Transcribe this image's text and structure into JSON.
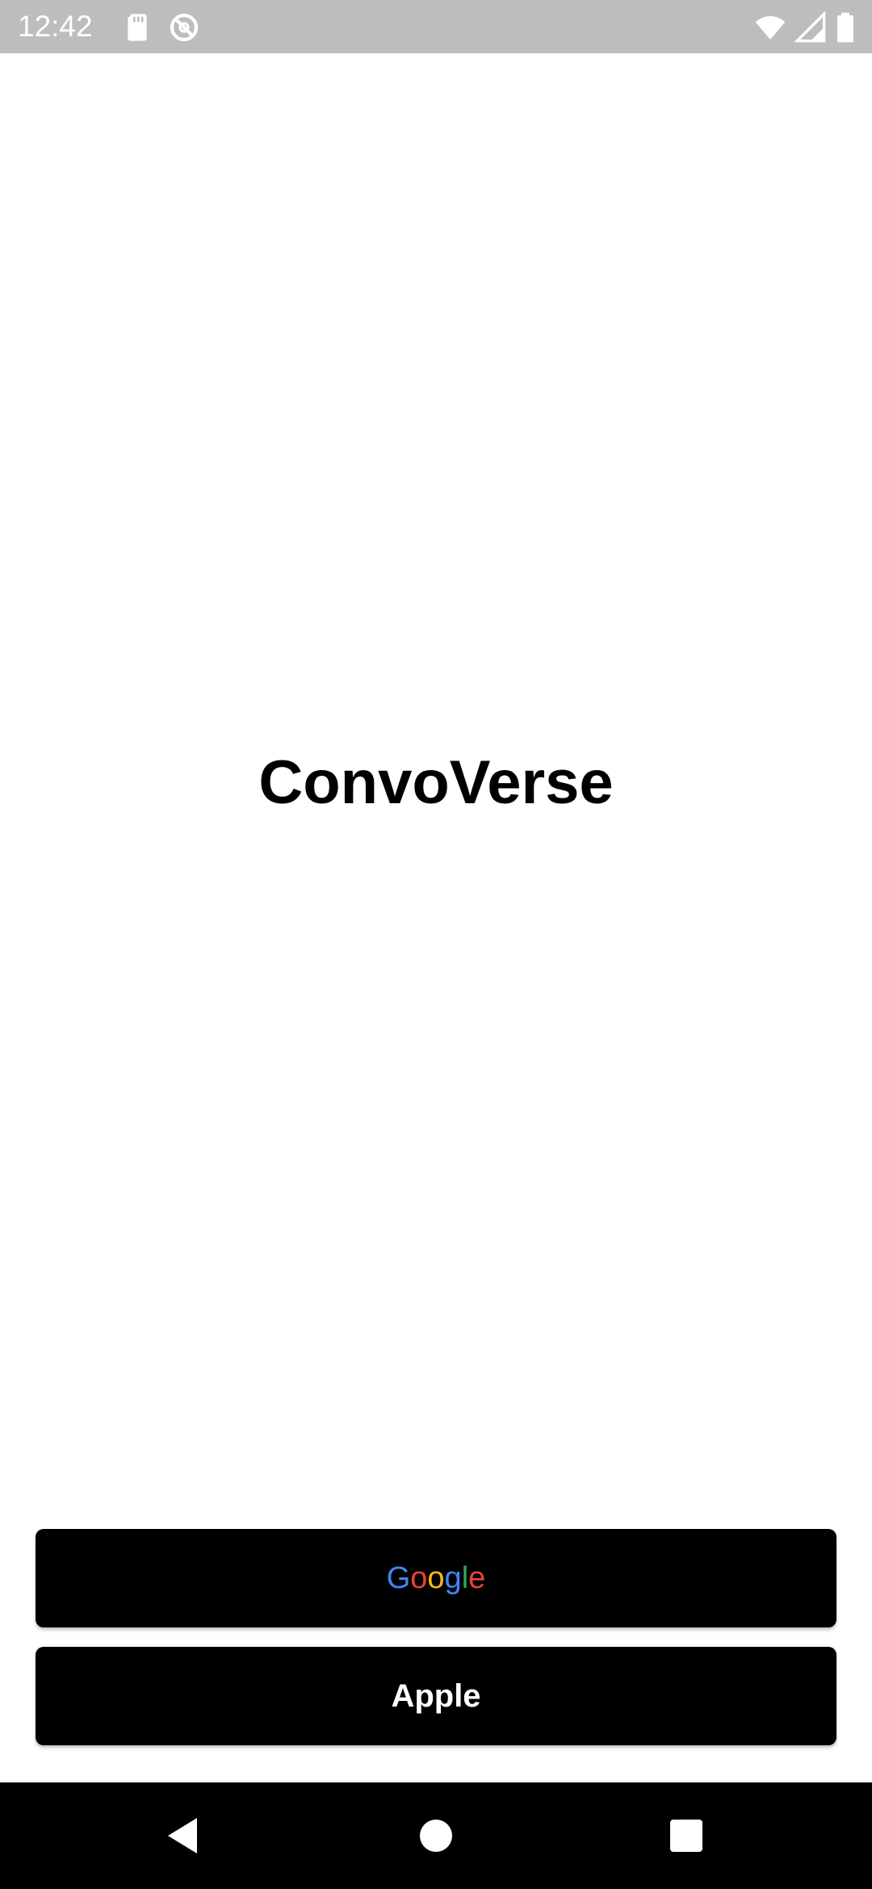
{
  "status_bar": {
    "time": "12:42",
    "icons": [
      "sd-card-icon",
      "do-not-disturb-icon",
      "wifi-icon",
      "cell-signal-icon",
      "battery-icon"
    ]
  },
  "app": {
    "title": "ConvoVerse"
  },
  "buttons": {
    "google": {
      "letters": [
        "G",
        "o",
        "o",
        "g",
        "l",
        "e"
      ],
      "colors": [
        "#4285F4",
        "#EA4335",
        "#FBBC05",
        "#4285F4",
        "#34A853",
        "#EA4335"
      ]
    },
    "apple": {
      "label": "Apple"
    }
  },
  "nav_bar": {
    "items": [
      "back-icon",
      "home-icon",
      "recents-icon"
    ]
  },
  "colors": {
    "status_bar_bg": "#bdbdbd",
    "button_bg": "#000000",
    "nav_bar_bg": "#000000"
  }
}
